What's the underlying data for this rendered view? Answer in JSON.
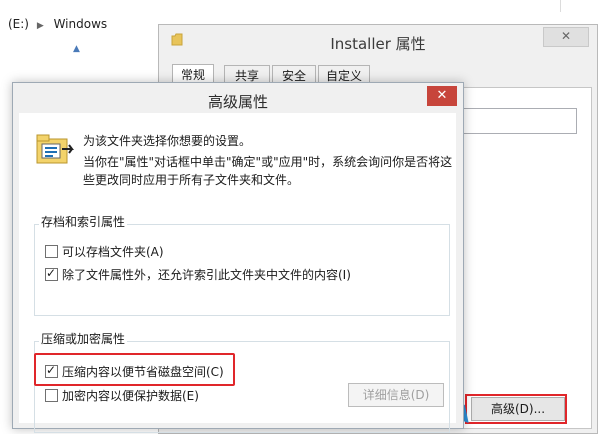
{
  "explorer": {
    "drive": "(E:)",
    "folder": "Windows"
  },
  "properties_window": {
    "title": "Installer 属性",
    "close_label": "✕",
    "tabs": [
      {
        "label": "常规",
        "active": true
      },
      {
        "label": "共享",
        "active": false
      },
      {
        "label": "安全",
        "active": false
      },
      {
        "label": "自定义",
        "active": false
      }
    ],
    "advanced_button": "高级(D)..."
  },
  "advanced_dialog": {
    "title": "高级属性",
    "close_label": "✕",
    "intro_line1": "为该文件夹选择你想要的设置。",
    "intro_line2": "当你在\"属性\"对话框中单击\"确定\"或\"应用\"时，系统会询问你是否将这",
    "intro_line3": "些更改同时应用于所有子文件夹和文件。",
    "archive_group": {
      "label": "存档和索引属性",
      "options": [
        {
          "label": "可以存档文件夹(A)",
          "checked": false
        },
        {
          "label": "除了文件属性外，还允许索引此文件夹中文件的内容(I)",
          "checked": true
        }
      ]
    },
    "compress_group": {
      "label": "压缩或加密属性",
      "options": [
        {
          "label": "压缩内容以便节省磁盘空间(C)",
          "checked": true
        },
        {
          "label": "加密内容以便保护数据(E)",
          "checked": false
        }
      ],
      "details_button": "详细信息(D)"
    }
  },
  "colors": {
    "highlight": "#e0262a",
    "close_button": "#c7453b",
    "arrow": "#2b8fd6"
  }
}
